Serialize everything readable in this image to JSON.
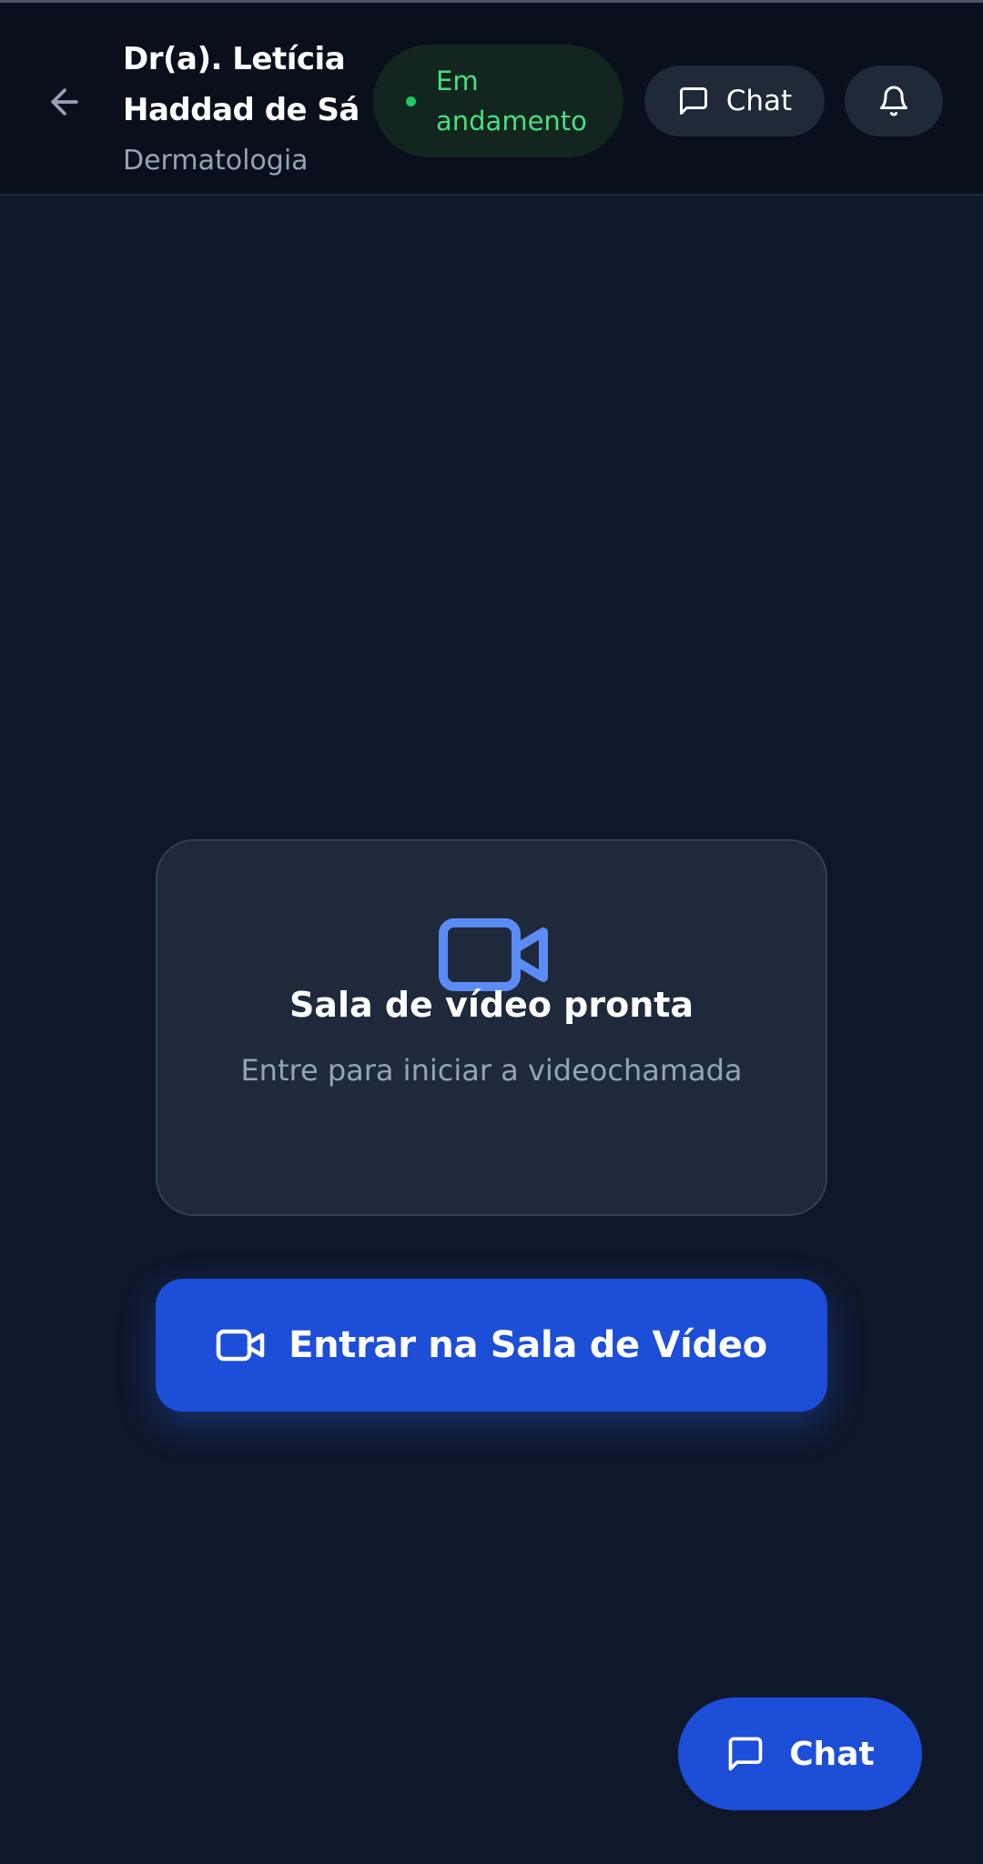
{
  "header": {
    "doctor_name": "Dr(a). Letícia Haddad de Sá",
    "specialty": "Dermatologia",
    "status": "Em andamento",
    "chat_label": "Chat"
  },
  "icons": {
    "back": "arrow-left-icon",
    "chat": "message-square-icon",
    "bell": "bell-icon",
    "video": "video-camera-icon"
  },
  "card": {
    "title": "Sala de vídeo pronta",
    "subtitle": "Entre para iniciar a videochamada"
  },
  "enter_button": {
    "label": "Entrar na Sala de Vídeo"
  },
  "floating_chat": {
    "label": "Chat"
  },
  "colors": {
    "background": "#0f172a",
    "header": "#0a0f1c",
    "card": "#1e293b",
    "primary": "#1d4ed8",
    "status_green": "#4ade80",
    "accent_icon": "#5b8cf6",
    "muted_text": "#94a3b8"
  }
}
